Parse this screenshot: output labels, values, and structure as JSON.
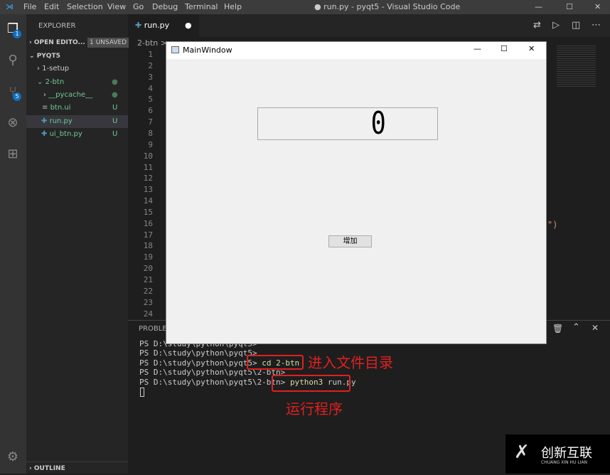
{
  "titlebar": {
    "menu": [
      "File",
      "Edit",
      "Selection",
      "View",
      "Go",
      "Debug",
      "Terminal",
      "Help"
    ],
    "title": "● run.py - pyqt5 - Visual Studio Code"
  },
  "activity": {
    "explorer_badge": "1",
    "scm_badge": "5"
  },
  "sidebar": {
    "header": "EXPLORER",
    "open_editors": "OPEN EDITO...",
    "unsaved": "1 UNSAVED",
    "root": "PYQT5",
    "items": [
      {
        "label": "1-setup",
        "status": ""
      },
      {
        "label": "2-btn",
        "status": "●"
      },
      {
        "label": "__pycache__",
        "status": "●"
      },
      {
        "label": "btn.ui",
        "status": "U"
      },
      {
        "label": "run.py",
        "status": "U"
      },
      {
        "label": "ui_btn.py",
        "status": "U"
      }
    ],
    "outline": "OUTLINE"
  },
  "editor": {
    "tab": "run.py",
    "tab_dirty": "●",
    "breadcrumb": "2-btn >",
    "lines": [
      "1",
      "2",
      "3",
      "4",
      "5",
      "6",
      "7",
      "8",
      "9",
      "10",
      "11",
      "12",
      "13",
      "14",
      "15",
      "16",
      "17",
      "18",
      "19",
      "20",
      "21",
      "22",
      "23",
      "24"
    ],
    "code_fragment": "\")"
  },
  "panel": {
    "tab": "PROBLEMS",
    "terminal": [
      {
        "prompt": "PS D:\\study\\python\\pyqt5>",
        "cmd": ""
      },
      {
        "prompt": "PS D:\\study\\python\\pyqt5>",
        "cmd": ""
      },
      {
        "prompt": "PS D:\\study\\python\\pyqt5>",
        "cmd": "cd 2-btn"
      },
      {
        "prompt": "PS D:\\study\\python\\pyqt5\\2-btn>",
        "cmd": ""
      },
      {
        "prompt": "PS D:\\study\\python\\pyqt5\\2-btn>",
        "cmd_kw": "python3",
        "cmd": " run.py"
      }
    ]
  },
  "annotations": {
    "cd": "进入文件目录",
    "run": "运行程序"
  },
  "mainwindow": {
    "title": "MainWindow",
    "lcd_value": "0",
    "button": "增加"
  },
  "logo": {
    "text": "创新互联",
    "sub": "CHUANG XIN HU LIAN"
  }
}
